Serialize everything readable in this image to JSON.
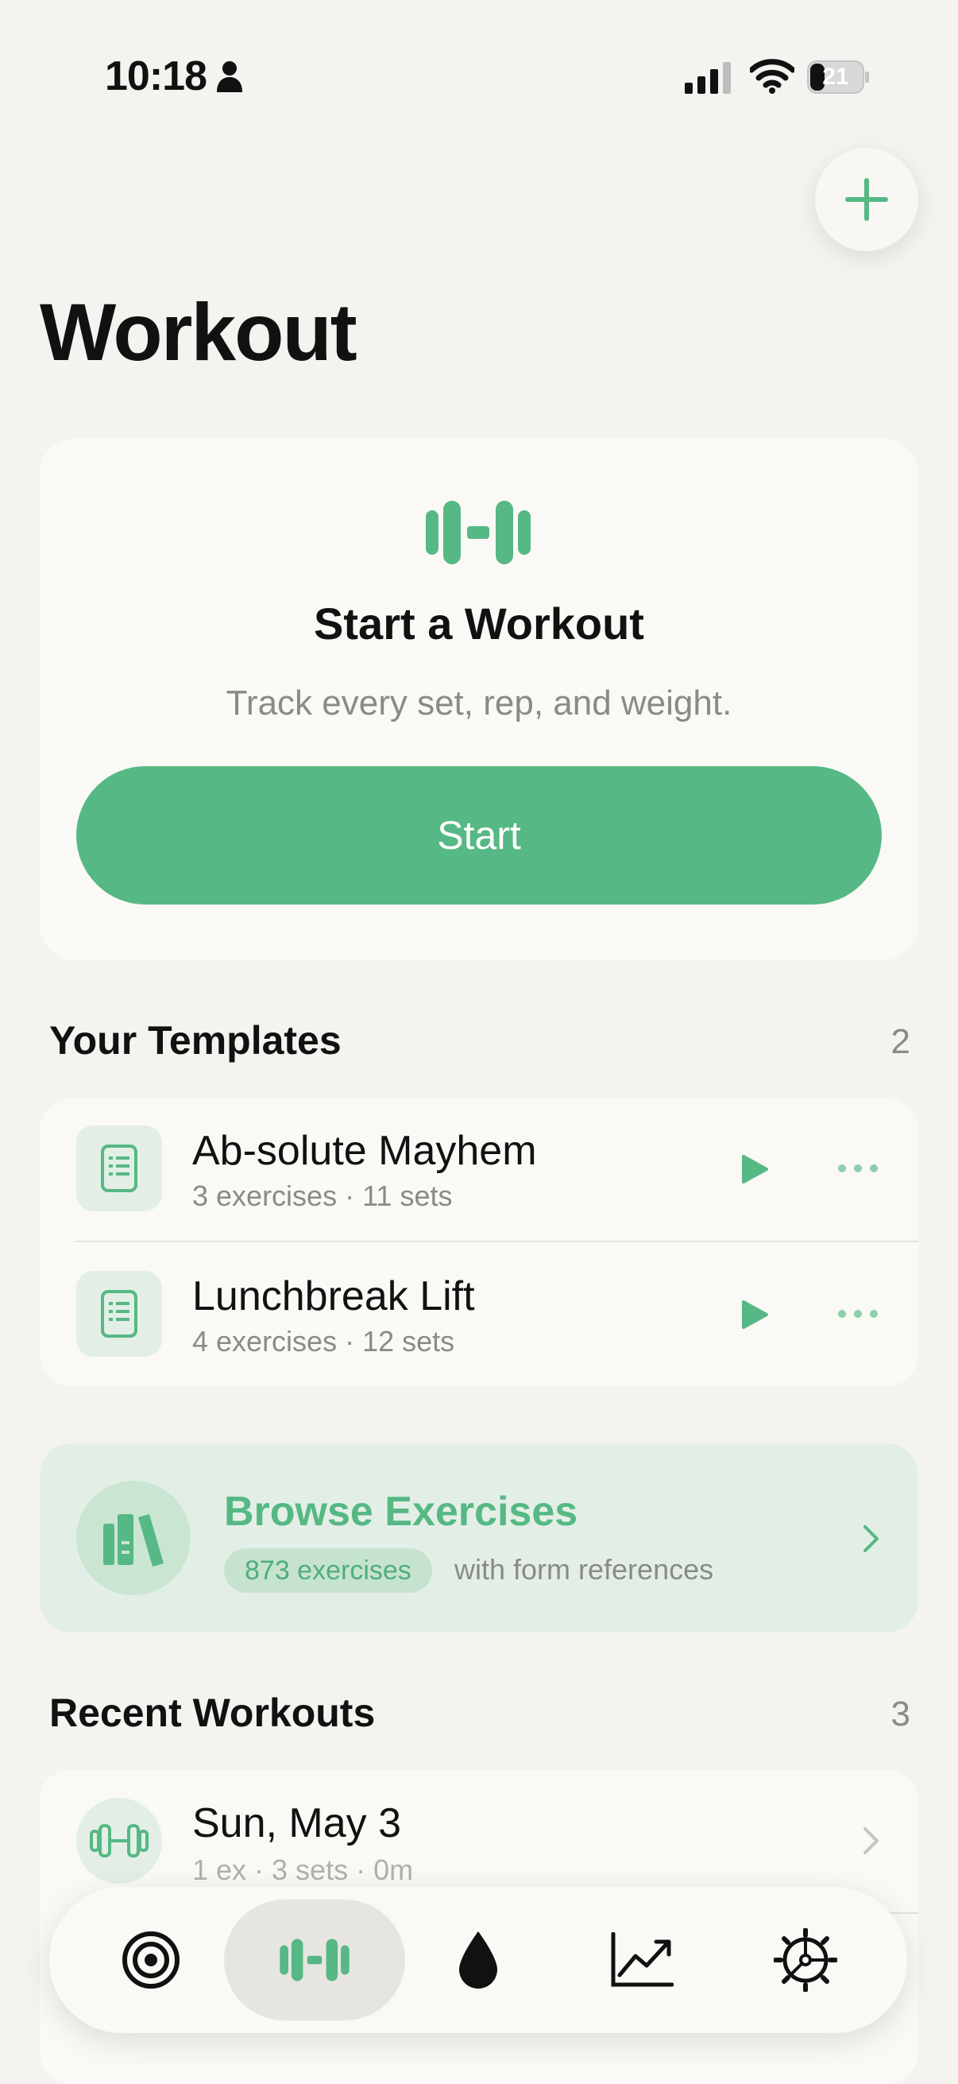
{
  "status_bar": {
    "time": "10:18",
    "battery": "21"
  },
  "page": {
    "title": "Workout"
  },
  "start_card": {
    "title": "Start a Workout",
    "subtitle": "Track every set, rep, and weight.",
    "button_label": "Start"
  },
  "templates": {
    "title": "Your Templates",
    "count": "2",
    "items": [
      {
        "name": "Ab-solute Mayhem",
        "detail": "3 exercises · 11 sets"
      },
      {
        "name": "Lunchbreak Lift",
        "detail": "4 exercises · 12 sets"
      }
    ]
  },
  "browse": {
    "title": "Browse Exercises",
    "badge": "873 exercises",
    "subtitle": "with form references"
  },
  "recent": {
    "title": "Recent Workouts",
    "count": "3",
    "items": [
      {
        "name": "Sun, May 3",
        "detail": "1 ex · 3 sets · 0m"
      }
    ]
  },
  "tab_bar": {
    "tabs": [
      "target-icon",
      "dumbbell-icon",
      "drop-icon",
      "chart-icon",
      "gear-icon"
    ],
    "selected": "dumbbell-icon"
  },
  "colors": {
    "accent": "#56b884",
    "accent_light": "#e3efe6",
    "background": "#f4f3ef",
    "card": "#faf9f5"
  }
}
